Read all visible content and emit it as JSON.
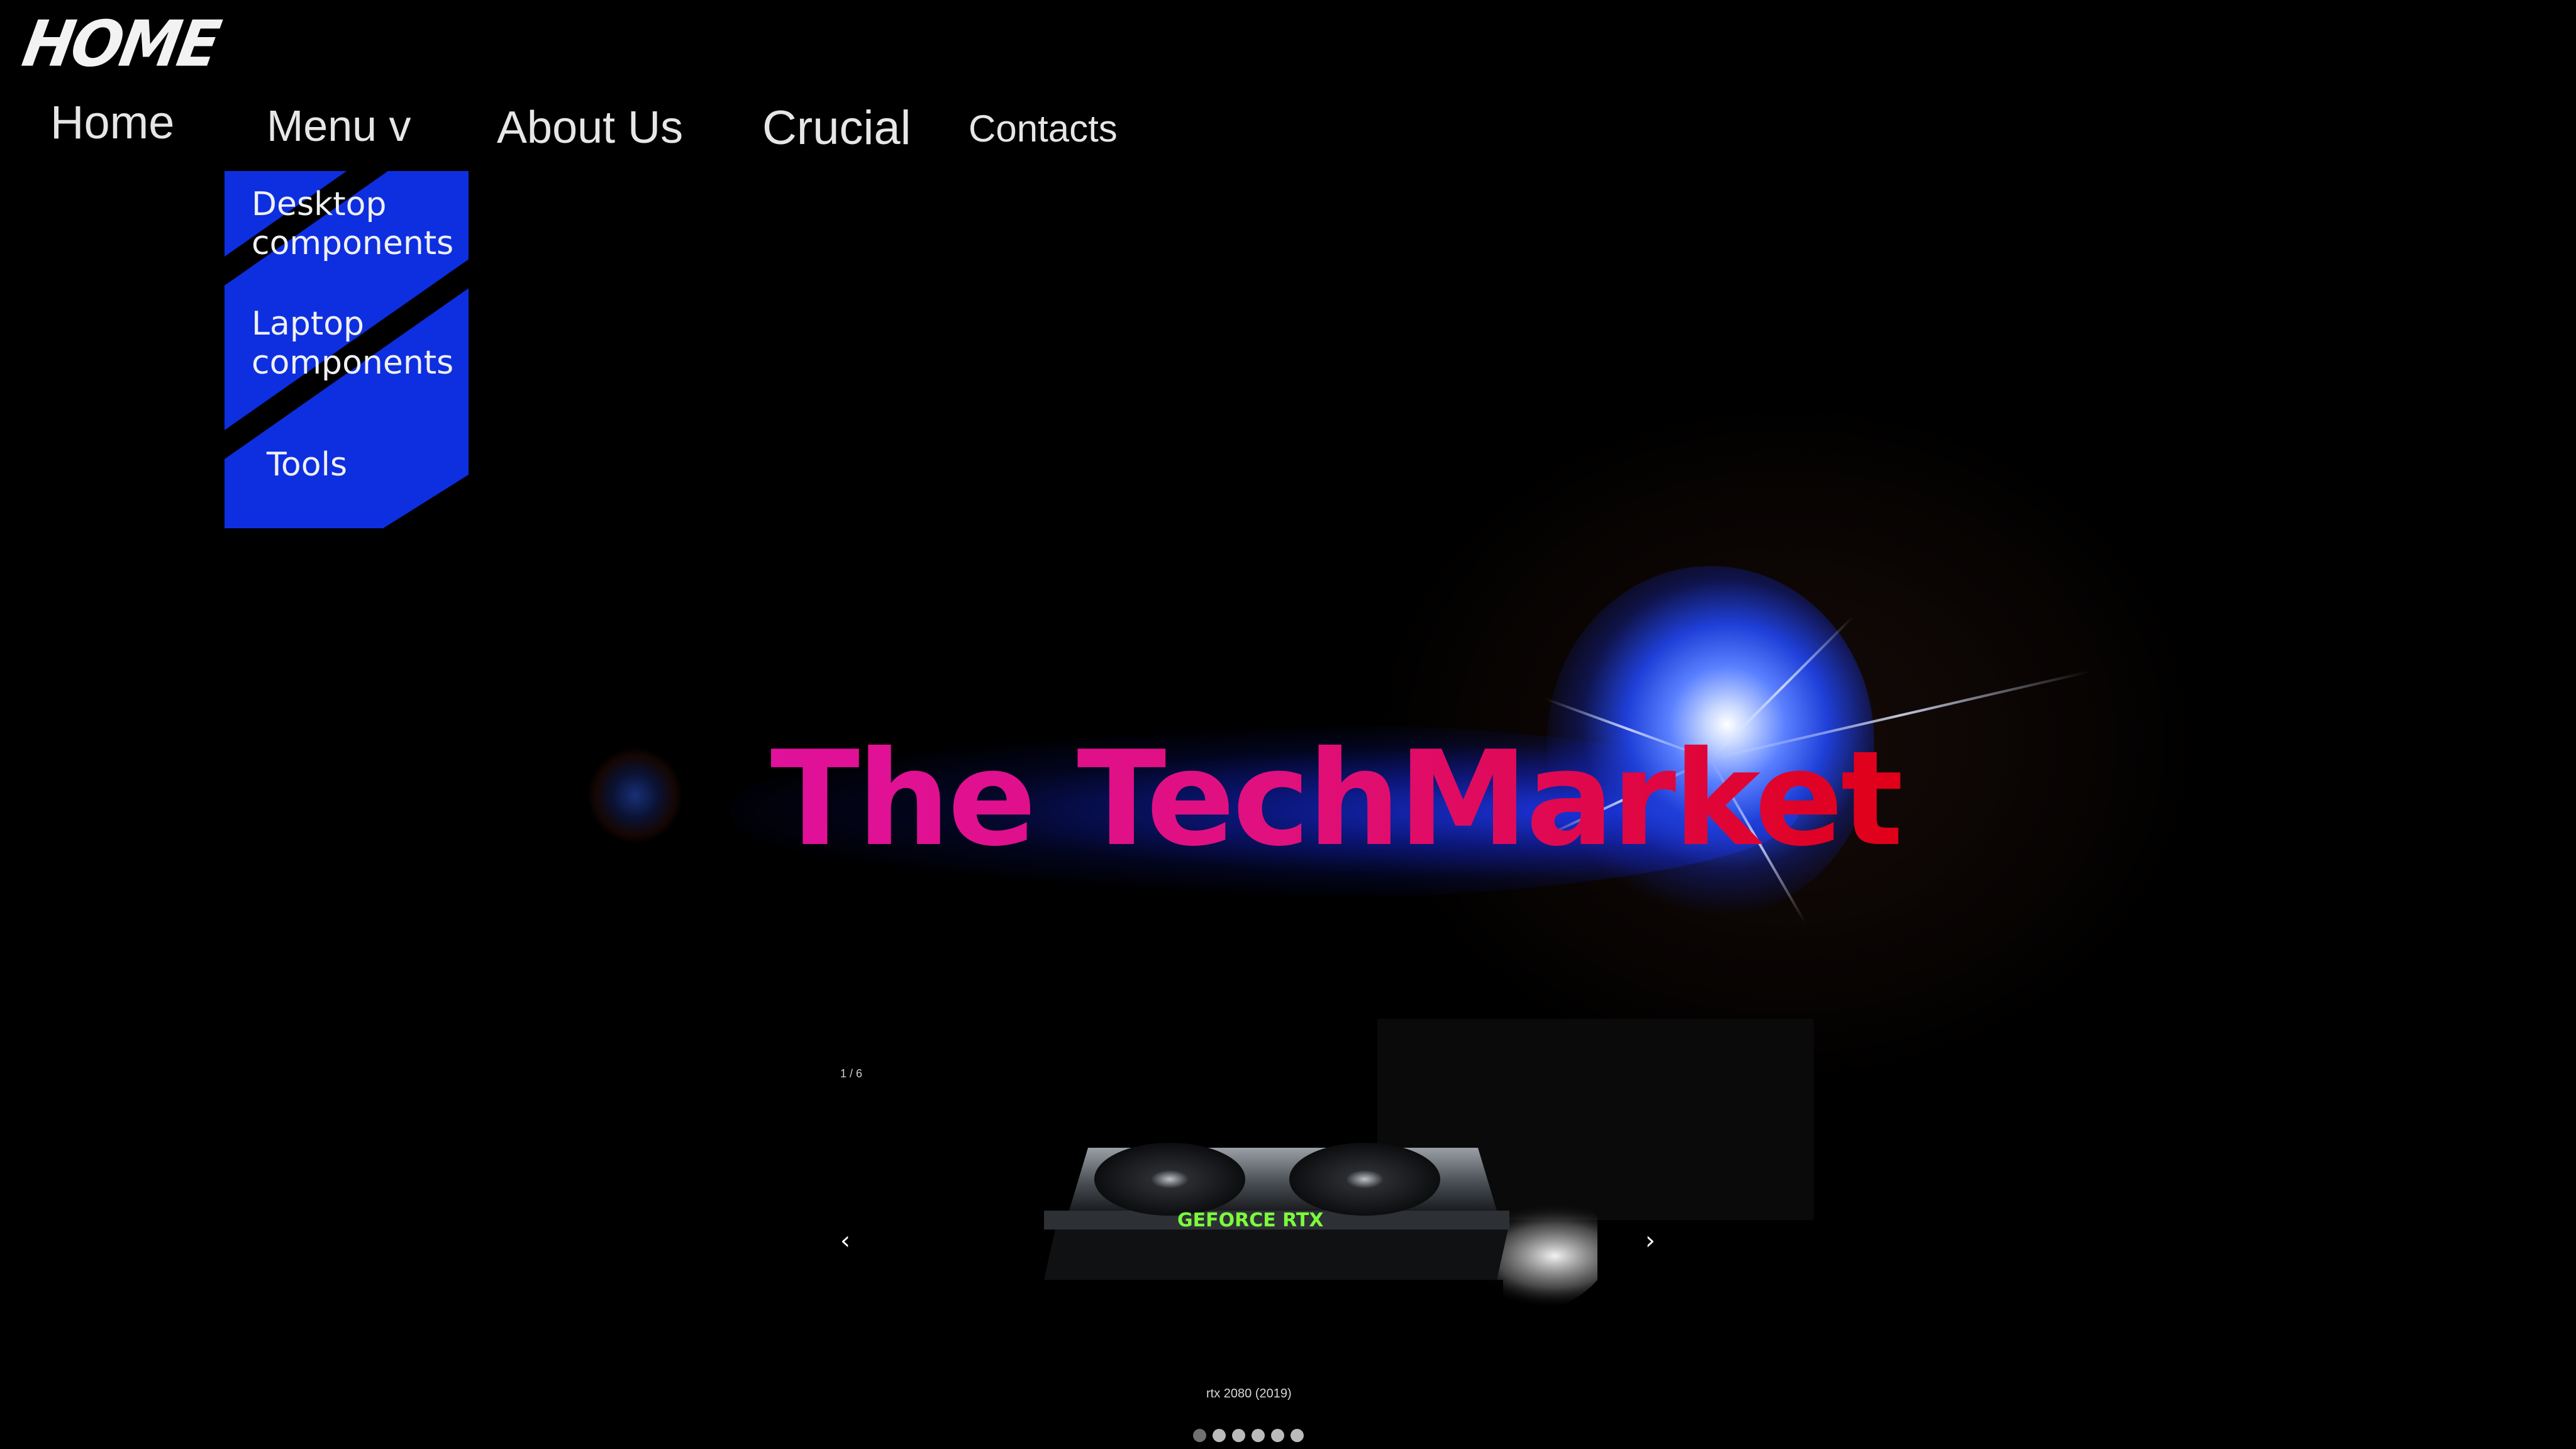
{
  "header": {
    "logo_text": "HOME"
  },
  "nav": {
    "home": "Home",
    "menu": "Menu v",
    "about": "About Us",
    "crucial": "Crucial",
    "contacts": "Contacts"
  },
  "dropdown": {
    "items": [
      "Desktop components",
      "Laptop components",
      "Tools"
    ]
  },
  "hero": {
    "title": "The TechMarket"
  },
  "slideshow": {
    "counter": "1 / 6",
    "prev_label": "‹",
    "next_label": "›",
    "image_text": "GEFORCE RTX",
    "caption": "rtx 2080 (2019)",
    "dot_count": 6,
    "active_dot": 0
  },
  "colors": {
    "dropdown_bg": "#0d2fe0",
    "title_start": "#e0119a",
    "title_end": "#e00018",
    "accent_green": "#7cfc3c"
  }
}
